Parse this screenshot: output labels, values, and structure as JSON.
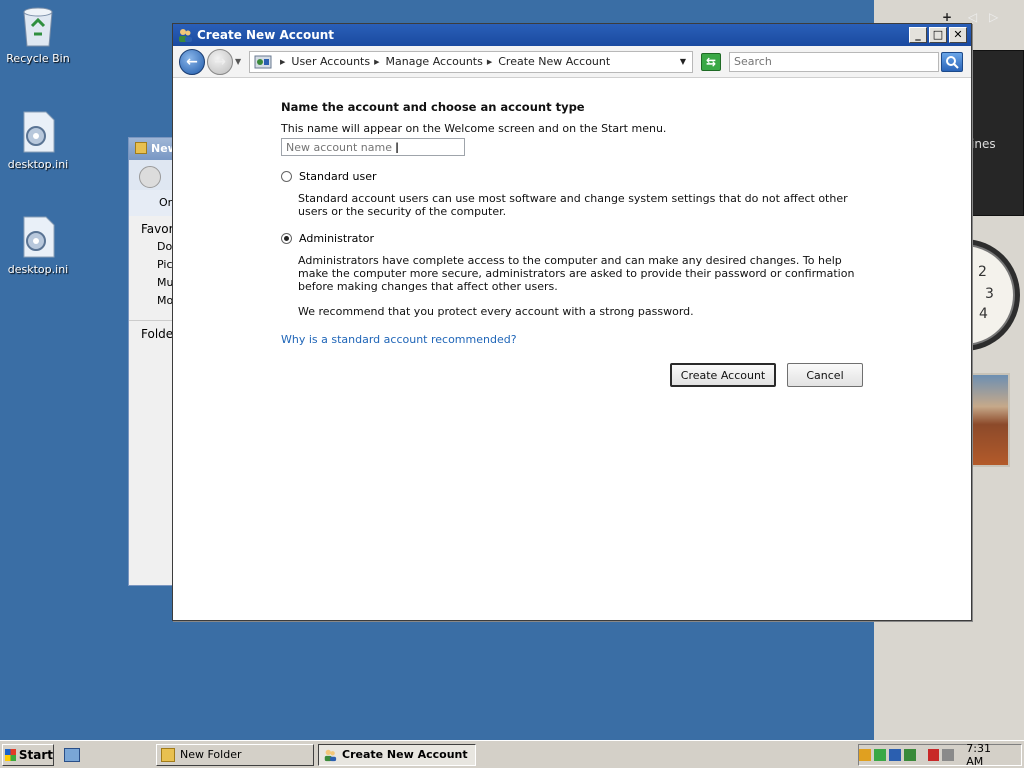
{
  "desktop": {
    "icons": [
      {
        "label": "Recycle Bin"
      },
      {
        "label": "desktop.ini"
      },
      {
        "label": "desktop.ini"
      }
    ]
  },
  "sidebar": {
    "gadget_text": "ines",
    "clock_numbers": [
      "2",
      "3",
      "4"
    ]
  },
  "background_window": {
    "title": "New",
    "organize": "Or",
    "favorites": "Favori",
    "items": [
      "Doc",
      "Pict",
      "Mu",
      "Mo"
    ],
    "folders": "Folde"
  },
  "window": {
    "title": "Create New Account",
    "buttons": {
      "minimize": "_",
      "maximize": "□",
      "close": "✕"
    }
  },
  "navbar": {
    "breadcrumbs": [
      "User Accounts",
      "Manage Accounts",
      "Create New Account"
    ],
    "search_placeholder": "Search"
  },
  "content": {
    "heading": "Name the account and choose an account type",
    "helper": "This name will appear on the Welcome screen and on the Start menu.",
    "name_placeholder": "New account name",
    "options": [
      {
        "label": "Standard user",
        "checked": false,
        "description": "Standard account users can use most software and change system settings that do not affect other users or the security of the computer."
      },
      {
        "label": "Administrator",
        "checked": true,
        "description": "Administrators have complete access to the computer and can make any desired changes. To help make the computer more secure, administrators are asked to provide their password or confirmation before making changes that affect other users."
      }
    ],
    "recommendation": "We recommend that you protect every account with a strong password.",
    "link": "Why is a standard account recommended?",
    "create_button": "Create Account",
    "cancel_button": "Cancel"
  },
  "taskbar": {
    "start": "Start",
    "tasks": [
      {
        "label": "New Folder",
        "active": false
      },
      {
        "label": "Create New Account",
        "active": true
      }
    ],
    "clock": "7:31 AM"
  },
  "colors": {
    "desktop": "#3a6ea5",
    "titlebar": "#1a4aa0",
    "link": "#2066b8"
  }
}
